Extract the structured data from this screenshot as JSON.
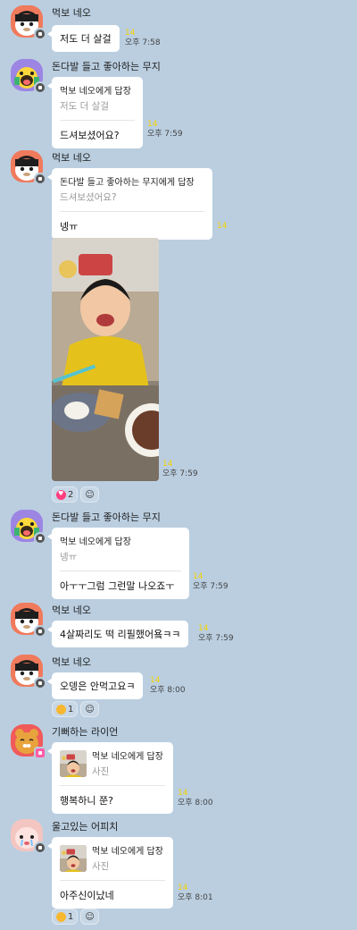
{
  "messages": [
    {
      "sender": "먹보 네오",
      "text": "저도 더 살걸",
      "unread": "14",
      "time": "오후 7:58"
    },
    {
      "sender": "돈다발 들고 좋아하는 무지",
      "reply_to": "먹보 네오에게 답장",
      "quote": "저도 더 살걸",
      "text": "드셔보셨어요?",
      "unread": "14",
      "time": "오후 7:59"
    },
    {
      "sender": "먹보 네오",
      "reply_to": "돈다발 들고 좋아하는 무지에게 답장",
      "quote": "드셔보셨어요?",
      "text": "넹ㅠ",
      "unread": "14"
    },
    {
      "photo_unread": "14",
      "photo_time": "오후 7:59",
      "reaction_count": "2"
    },
    {
      "sender": "돈다발 들고 좋아하는 무지",
      "reply_to": "먹보 네오에게 답장",
      "quote": "넹ㅠ",
      "text": "아ㅜㅜ그럼 그런말 나오죠ㅜ",
      "unread": "14",
      "time": "오후 7:59"
    },
    {
      "sender": "먹보 네오",
      "text": "4살짜리도 떡 리필했어욬ㅋㅋ",
      "unread": "14",
      "time": "오후 7:59"
    },
    {
      "sender": "먹보 네오",
      "text": "오뎅은 안먹고요ㅋ",
      "unread": "14",
      "time": "오후 8:00",
      "reaction_count": "1"
    },
    {
      "sender": "기뻐하는 라이언",
      "reply_to": "먹보 네오에게 답장",
      "quote": "사진",
      "text": "행복하니 쭌?",
      "unread": "14",
      "time": "오후 8:00"
    },
    {
      "sender": "울고있는 어피치",
      "reply_to": "먹보 네오에게 답장",
      "quote": "사진",
      "text": "아주신이났네",
      "unread": "14",
      "time": "오후 8:01",
      "reaction_count": "1"
    }
  ],
  "colors": {
    "background": "#bacee0",
    "bubble": "#ffffff",
    "unread": "#f5d200",
    "reaction_heart": "#ff3d7f"
  },
  "icons": [
    "neo-avatar",
    "muzi-avatar",
    "ryan-avatar",
    "apeach-avatar",
    "heart-icon",
    "laugh-emoji-icon",
    "person-icon"
  ]
}
